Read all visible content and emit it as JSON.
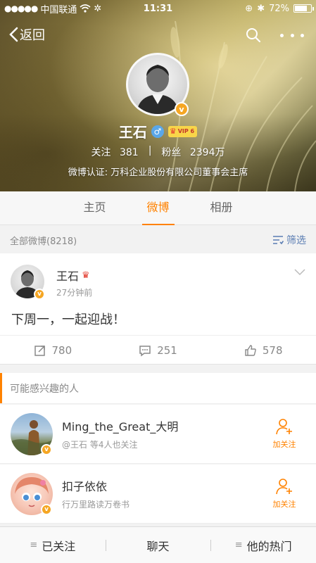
{
  "status_bar": {
    "signal_dots": "●●●●●",
    "carrier": "中国联通",
    "time": "11:31",
    "battery": "72%"
  },
  "nav": {
    "back_label": "返回"
  },
  "profile": {
    "name": "王石",
    "gender_symbol": "♂",
    "vip_label": "VIP 6",
    "follow_label": "关注",
    "follow_count": "381",
    "separator": "|",
    "fans_label": "粉丝",
    "fans_count": "2394万",
    "verification": "微博认证: 万科企业股份有限公司董事会主席",
    "verified_badge": "v"
  },
  "tabs": [
    {
      "label": "主页"
    },
    {
      "label": "微博",
      "active": true
    },
    {
      "label": "相册"
    }
  ],
  "feed": {
    "all_posts_label": "全部微博(8218)",
    "filter_label": "筛选"
  },
  "post": {
    "author": "王石",
    "time": "27分钟前",
    "text": "下周一，一起迎战！",
    "reposts": "780",
    "comments": "251",
    "likes": "578"
  },
  "suggestions": {
    "title": "可能感兴趣的人",
    "follow_label": "加关注",
    "items": [
      {
        "name": "Ming_the_Great_大明",
        "desc": "@王石 等4人也关注"
      },
      {
        "name": "扣子依依",
        "desc": "行万里路读万卷书"
      }
    ]
  },
  "bottom_bar": {
    "followed": "已关注",
    "chat": "聊天",
    "hot": "他的热门"
  },
  "colors": {
    "accent": "#ff8200",
    "link": "#5a7db3",
    "verified": "#f5a623"
  }
}
